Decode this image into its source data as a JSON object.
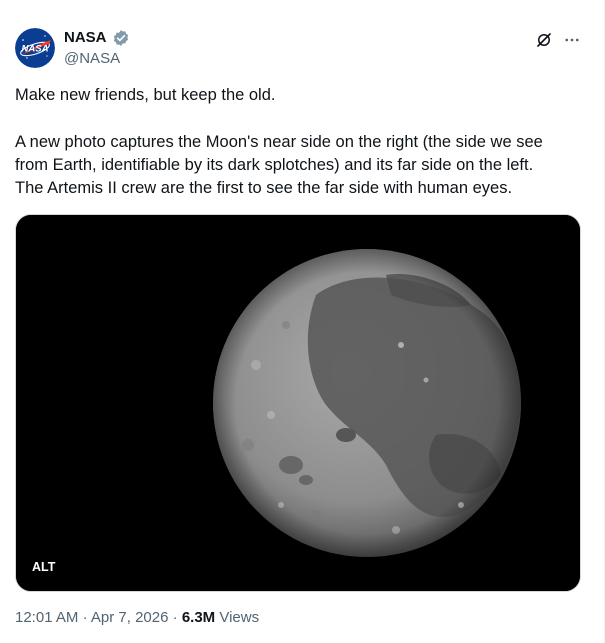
{
  "author": {
    "display_name": "NASA",
    "handle": "@NASA",
    "verified": true,
    "avatar_label": "NASA",
    "verified_color": "#1d9bf0"
  },
  "tweet": {
    "line1": "Make new friends, but keep the old.",
    "paragraph2_lines": [
      "A new photo captures the Moon's near side on the right (the side we see",
      "from Earth, identifiable by its dark splotches) and its far side on the left.",
      "The Artemis II crew are the first to see the far side with human eyes."
    ]
  },
  "media": {
    "alt_badge": "ALT",
    "image_subject": "moon-photo"
  },
  "meta": {
    "time": "12:01 AM",
    "separator": "·",
    "date": "Apr 7, 2026",
    "views_count": "6.3M",
    "views_label": "Views"
  },
  "icons": {
    "grok": "grok-icon",
    "more": "more-icon",
    "verified": "verified-badge-icon"
  },
  "colors": {
    "text_primary": "#0f1419",
    "text_secondary": "#536471",
    "nasa_blue": "#0b3d91",
    "nasa_red": "#fc3d21",
    "media_background": "#000000"
  }
}
